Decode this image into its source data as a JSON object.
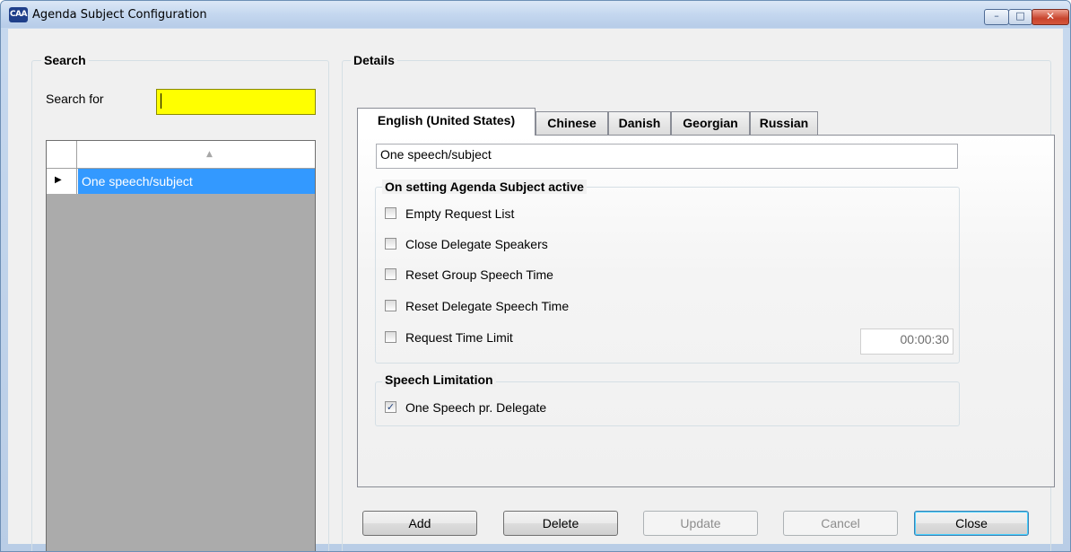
{
  "window": {
    "title": "Agenda Subject Configuration",
    "app_icon_text": "CAA",
    "controls": {
      "minimize": "–",
      "maximize": "□",
      "close": "✕"
    }
  },
  "search": {
    "group_label": "Search",
    "search_for_label": "Search for",
    "search_value": "",
    "search_field_color": "#ffff00",
    "grid": {
      "sort_indicator": "▲",
      "rows": [
        {
          "label": "One speech/subject",
          "selected": true,
          "row_indicator": "▶"
        }
      ]
    }
  },
  "details": {
    "group_label": "Details",
    "tabs": [
      {
        "label": "English (United States)",
        "active": true
      },
      {
        "label": "Chinese",
        "active": false
      },
      {
        "label": "Danish",
        "active": false
      },
      {
        "label": "Georgian",
        "active": false
      },
      {
        "label": "Russian",
        "active": false
      }
    ],
    "name_value": "One speech/subject",
    "active_group": {
      "label": "On setting Agenda Subject active",
      "options": [
        {
          "label": "Empty Request List",
          "checked": false
        },
        {
          "label": "Close Delegate Speakers",
          "checked": false
        },
        {
          "label": "Reset Group Speech Time",
          "checked": false
        },
        {
          "label": "Reset Delegate Speech Time",
          "checked": false
        },
        {
          "label": "Request Time Limit",
          "checked": false
        }
      ],
      "time_limit_value": "00:00:30"
    },
    "speech_limitation": {
      "label": "Speech Limitation",
      "options": [
        {
          "label": "One Speech pr. Delegate",
          "checked": true
        }
      ]
    }
  },
  "buttons": {
    "add": "Add",
    "delete": "Delete",
    "update": "Update",
    "cancel": "Cancel",
    "close": "Close"
  },
  "check_mark": "✓"
}
